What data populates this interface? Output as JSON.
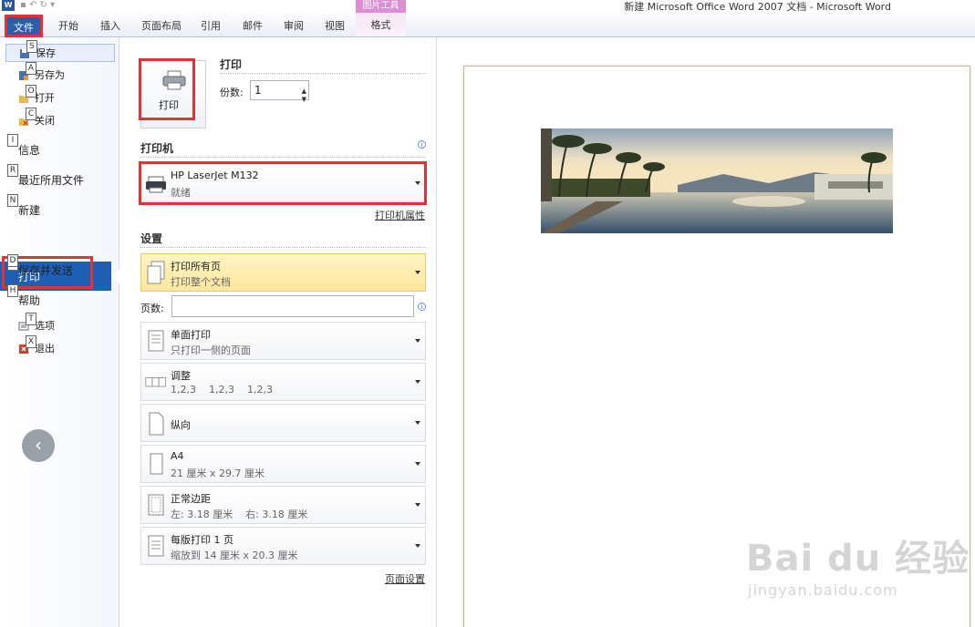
{
  "window": {
    "title": "新建 Microsoft Office Word 2007 文档 - Microsoft Word",
    "logo": "W"
  },
  "ribbon": {
    "tabs": [
      "文件",
      "开始",
      "插入",
      "页面布局",
      "引用",
      "邮件",
      "审阅",
      "视图"
    ],
    "context_group": "图片工具",
    "context_tab": "格式"
  },
  "nav": {
    "quick_items": [
      {
        "label": "保存",
        "key": "S",
        "icon": "save-icon"
      },
      {
        "label": "另存为",
        "key": "A",
        "icon": "save-as-icon"
      },
      {
        "label": "打开",
        "key": "O",
        "icon": "open-folder-icon"
      },
      {
        "label": "关闭",
        "key": "C",
        "icon": "close-folder-icon"
      }
    ],
    "sections": [
      {
        "label": "信息",
        "key": "I"
      },
      {
        "label": "最近所用文件",
        "key": "R"
      },
      {
        "label": "新建",
        "key": "N"
      },
      {
        "label": "打印",
        "key": "P"
      },
      {
        "label": "保存并发送",
        "key": "D"
      },
      {
        "label": "帮助",
        "key": "H"
      }
    ],
    "bottom_items": [
      {
        "label": "选项",
        "key": "T",
        "icon": "options-icon"
      },
      {
        "label": "退出",
        "key": "X",
        "icon": "exit-icon"
      }
    ],
    "back_glyph": "‹"
  },
  "print": {
    "title": "打印",
    "button_label": "打印",
    "copies_label": "份数:",
    "copies_value": "1",
    "printer_section": "打印机",
    "printer_name": "HP LaserJet M132",
    "printer_status": "就绪",
    "printer_properties": "打印机属性",
    "settings_section": "设置",
    "pages_label": "页数:",
    "page_setup": "页面设置",
    "settings": [
      {
        "title": "打印所有页",
        "sub": "打印整个文档"
      },
      {
        "title": "单面打印",
        "sub": "只打印一侧的页面"
      },
      {
        "title": "调整",
        "sub": "1,2,3    1,2,3    1,2,3"
      },
      {
        "title": "纵向",
        "sub": ""
      },
      {
        "title": "A4",
        "sub": "21 厘米 x 29.7 厘米"
      },
      {
        "title": "正常边距",
        "sub": "左: 3.18 厘米    右: 3.18 厘米"
      },
      {
        "title": "每版打印 1 页",
        "sub": "缩放到 14 厘米 x 20.3 厘米"
      }
    ]
  },
  "watermark": {
    "brand": "Bai du 经验",
    "url": "jingyan.baidu.com"
  }
}
